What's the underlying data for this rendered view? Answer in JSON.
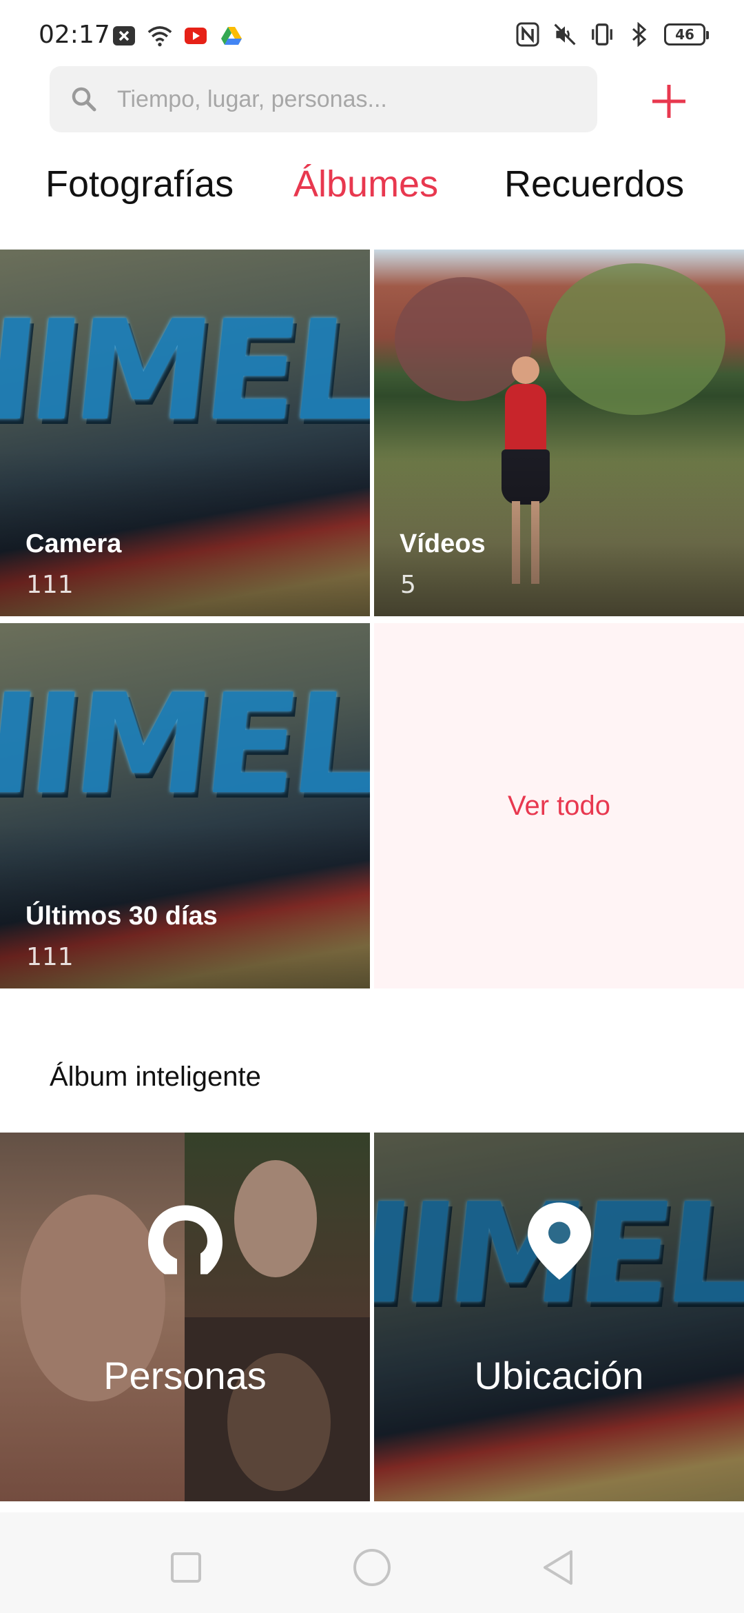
{
  "status_bar": {
    "time": "02:17",
    "left_icons": [
      "notification-icon",
      "wifi-icon",
      "youtube-icon",
      "drive-icon"
    ],
    "right_icons": [
      "nfc-icon",
      "mute-icon",
      "vibrate-icon",
      "bluetooth-icon"
    ],
    "battery": "46"
  },
  "search": {
    "placeholder": "Tiempo, lugar, personas..."
  },
  "tabs": [
    {
      "label": "Fotografías",
      "active": false
    },
    {
      "label": "Álbumes",
      "active": true
    },
    {
      "label": "Recuerdos",
      "active": false
    }
  ],
  "albums": [
    {
      "title": "Camera",
      "count": "111"
    },
    {
      "title": "Vídeos",
      "count": "5"
    },
    {
      "title": "Últimos 30 días",
      "count": "111"
    }
  ],
  "see_all": "Ver todo",
  "smart_section": {
    "title": "Álbum inteligente",
    "items": [
      {
        "label": "Personas",
        "icon": "person-icon"
      },
      {
        "label": "Ubicación",
        "icon": "location-pin-icon"
      }
    ]
  },
  "colors": {
    "accent": "#e8384f",
    "search_bg": "#f1f1f1",
    "see_all_bg": "#fff4f5",
    "nav_bg": "#f7f7f7"
  },
  "nav_bar": [
    "square-icon",
    "circle-icon",
    "back-triangle-icon"
  ]
}
